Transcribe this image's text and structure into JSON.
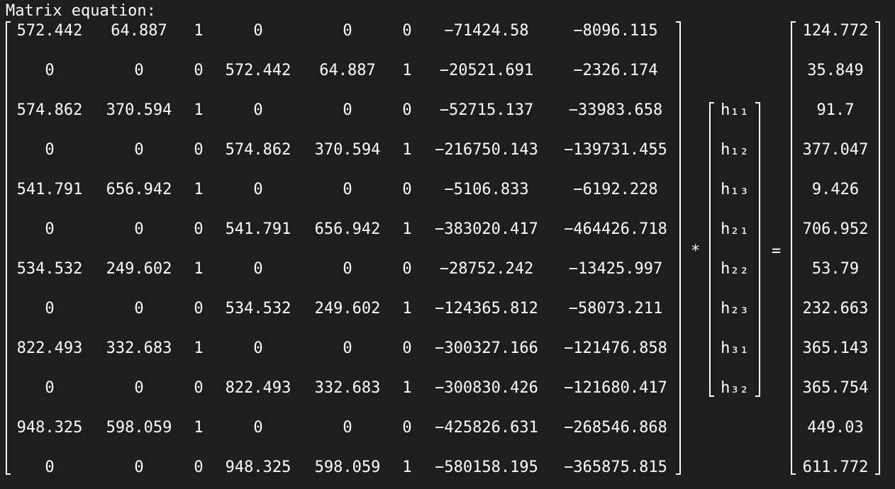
{
  "title": "Matrix equation:",
  "A": [
    [
      "572.442",
      "64.887",
      "1",
      "0",
      "0",
      "0",
      "−71424.58",
      "−8096.115"
    ],
    [
      "0",
      "0",
      "0",
      "572.442",
      "64.887",
      "1",
      "−20521.691",
      "−2326.174"
    ],
    [
      "574.862",
      "370.594",
      "1",
      "0",
      "0",
      "0",
      "−52715.137",
      "−33983.658"
    ],
    [
      "0",
      "0",
      "0",
      "574.862",
      "370.594",
      "1",
      "−216750.143",
      "−139731.455"
    ],
    [
      "541.791",
      "656.942",
      "1",
      "0",
      "0",
      "0",
      "−5106.833",
      "−6192.228"
    ],
    [
      "0",
      "0",
      "0",
      "541.791",
      "656.942",
      "1",
      "−383020.417",
      "−464426.718"
    ],
    [
      "534.532",
      "249.602",
      "1",
      "0",
      "0",
      "0",
      "−28752.242",
      "−13425.997"
    ],
    [
      "0",
      "0",
      "0",
      "534.532",
      "249.602",
      "1",
      "−124365.812",
      "−58073.211"
    ],
    [
      "822.493",
      "332.683",
      "1",
      "0",
      "0",
      "0",
      "−300327.166",
      "−121476.858"
    ],
    [
      "0",
      "0",
      "0",
      "822.493",
      "332.683",
      "1",
      "−300830.426",
      "−121680.417"
    ],
    [
      "948.325",
      "598.059",
      "1",
      "0",
      "0",
      "0",
      "−425826.631",
      "−268546.868"
    ],
    [
      "0",
      "0",
      "0",
      "948.325",
      "598.059",
      "1",
      "−580158.195",
      "−365875.815"
    ]
  ],
  "h": [
    "h₁₁",
    "h₁₂",
    "h₁₃",
    "h₂₁",
    "h₂₂",
    "h₂₃",
    "h₃₁",
    "h₃₂"
  ],
  "b": [
    "124.772",
    "35.849",
    "91.7",
    "377.047",
    "9.426",
    "706.952",
    "53.79",
    "232.663",
    "365.143",
    "365.754",
    "449.03",
    "611.772"
  ],
  "operators": {
    "multiply": "*",
    "equals": "="
  }
}
